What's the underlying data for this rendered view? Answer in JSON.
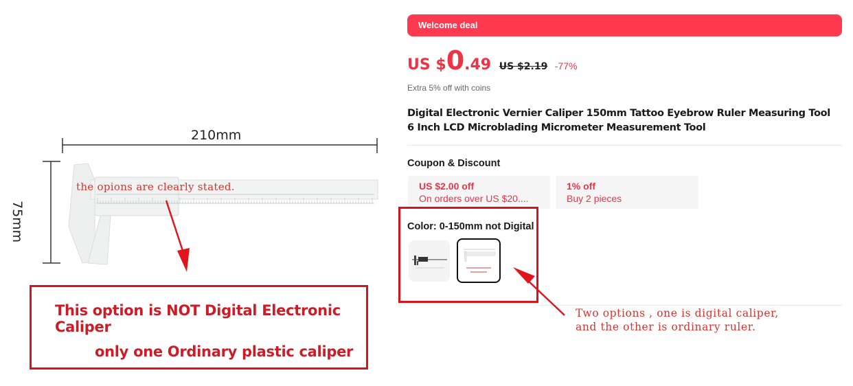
{
  "product_image": {
    "width_label": "210mm",
    "height_label": "75mm",
    "annotation": "the opions are clearly stated.",
    "warning": {
      "line1": "This option is NOT Digital Electronic Caliper",
      "line2": "only one Ordinary plastic caliper"
    }
  },
  "deal": {
    "banner_label": "Welcome deal",
    "banner_color": "#fe3950"
  },
  "price": {
    "prefix": "US $",
    "integer": "0",
    "decimal": ".49",
    "original": "US $2.19",
    "discount": "-77%",
    "accent_color": "#ee3347"
  },
  "coins_note": "Extra 5% off with coins",
  "product_title": "Digital Electronic Vernier Caliper 150mm Tattoo Eyebrow Ruler Measuring Tool 6 Inch LCD Microblading Micrometer Measurement Tool",
  "coupons": {
    "heading": "Coupon & Discount",
    "items": [
      {
        "title": "US $2.00 off",
        "subtitle": "On orders over US $20...."
      },
      {
        "title": "1% off",
        "subtitle": "Buy 2 pieces"
      }
    ]
  },
  "variant": {
    "label": "Color: ",
    "selected": "0-150mm not Digital",
    "options": [
      {
        "name": "digital caliper",
        "icon": "digital-caliper-thumbnail",
        "selected": false
      },
      {
        "name": "0-150mm not Digital",
        "icon": "plastic-caliper-thumbnail",
        "selected": true
      }
    ]
  },
  "annotation_right": {
    "line1": "Two options , one is digital caliper,",
    "line2": "and the other is ordinary ruler."
  }
}
